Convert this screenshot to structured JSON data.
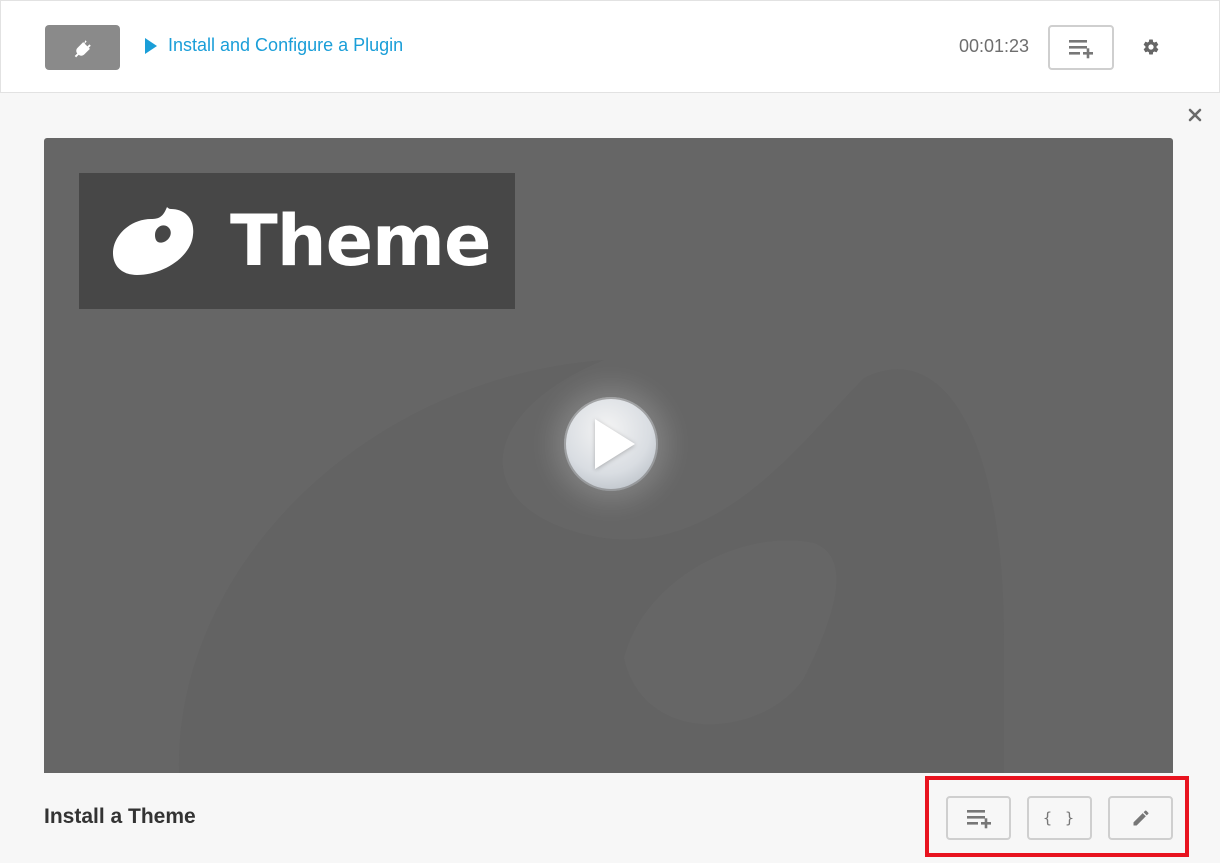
{
  "header": {
    "plugin_icon": "plug-icon",
    "current_video_title": "Install and Configure a Plugin",
    "timer": "00:01:23",
    "playlist_icon": "playlist-add-icon",
    "settings_icon": "gear-icon"
  },
  "content": {
    "close_icon": "close-icon",
    "video": {
      "badge_title": "Theme",
      "badge_icon": "palette-icon",
      "play_icon": "play-icon",
      "background_color": "#666666"
    },
    "caption": "Install a Theme",
    "actions": [
      {
        "name": "add-to-playlist",
        "icon": "playlist-add-icon"
      },
      {
        "name": "embed",
        "label": "{ }"
      },
      {
        "name": "edit",
        "icon": "pencil-icon"
      }
    ]
  },
  "colors": {
    "link": "#1a9ed8",
    "highlight": "#e8131f"
  }
}
